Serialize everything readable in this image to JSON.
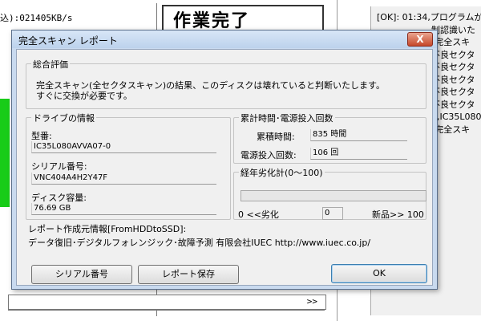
{
  "background": {
    "speed_text": "込):021405KB/s",
    "title_text": "作業完了",
    "log_lines": [
      "[OK]: 01:34,プログラムが",
      "制認識いた",
      ")完全スキ",
      "不良セクタ",
      "不良セクタ",
      "不良セクタ",
      "不良セクタ",
      "不良セクタ",
      "4,IC35L080",
      ")完全スキ"
    ],
    "scroll_text": ">>"
  },
  "dialog": {
    "title": "完全スキャン レポート",
    "close_glyph": "X",
    "overall": {
      "legend": "総合評価",
      "message_line1": "完全スキャン(全セクタスキャン)の結果、このディスクは壊れていると判断いたします。",
      "message_line2": "すぐに交換が必要です。"
    },
    "drive_info": {
      "legend": "ドライブの情報",
      "model_label": "型番:",
      "model_value": "IC35L080AVVA07-0",
      "serial_label": "シリアル番号:",
      "serial_value": "VNC404A4H2Y47F",
      "capacity_label": "ディスク容量:",
      "capacity_value": "76.69 GB"
    },
    "power_on": {
      "legend": "累計時間･電源投入回数",
      "hours_label": "累積時間:",
      "hours_value": "835 時間",
      "count_label": "電源投入回数:",
      "count_value": "106 回"
    },
    "aging": {
      "legend": "経年劣化計(0～100)",
      "left_label": "0 <<劣化",
      "current_value": "0",
      "right_label": "新品>> 100",
      "progress_percent": 0
    },
    "report_source": {
      "label": "レポート作成元情報[FromHDDtoSSD]:",
      "company": "データ復旧･デジタルフォレンジック･故障予測 有限会社IUEC http://www.iuec.co.jp/"
    },
    "buttons": {
      "serial": "シリアル番号",
      "save": "レポート保存",
      "ok": "OK"
    }
  }
}
